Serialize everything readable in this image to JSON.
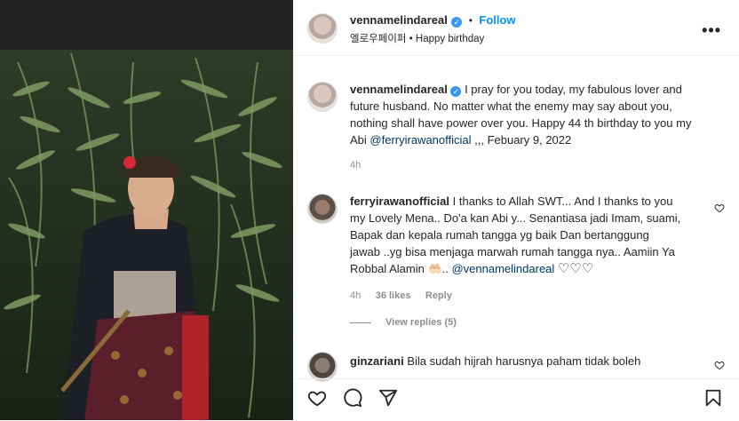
{
  "post": {
    "author": "vennamelindareal",
    "follow_label": "Follow",
    "dot": "•",
    "audio_artist": "엘로우페이퍼",
    "audio_separator": "•",
    "audio_track": "Happy birthday",
    "more_label": "•••"
  },
  "caption": {
    "username": "vennamelindareal",
    "text_line1": "I pray for you today, my fabulous lover and",
    "text_line2": "future husband. No matter what the enemy may say about you,",
    "text_line3": "nothing shall have power over you. Happy 44 th birthday to you my",
    "text_line4_pre": "Abi ",
    "mention": "@ferryirawanofficial",
    "text_line4_post": " ,,, Febuary 9, 2022",
    "time": "4h"
  },
  "comments": [
    {
      "username": "ferryirawanofficial",
      "line1": "I thanks to Allah SWT... And I thanks to you",
      "line2": "my Lovely Mena.. Do'a kan Abi y... Senantiasa jadi Imam, suami,",
      "line3": "Bapak dan kepala rumah tangga yg baik Dan bertanggung",
      "line4": "jawab ..yg bisa menjaga marwah rumah tangga nya.. Aamiin Ya",
      "line5_pre": "Robbal Alamin ",
      "emoji": "🤲🏻",
      "line5_mid": ".. ",
      "mention": "@vennamelindareal",
      "hearts": "♡♡♡",
      "time": "4h",
      "likes": "36 likes",
      "reply": "Reply",
      "view_replies": "View replies (5)"
    },
    {
      "username": "ginzariani",
      "text": "Bila sudah hijrah harusnya paham tidak boleh"
    }
  ],
  "icons": {
    "like": "heart-icon",
    "comment": "comment-icon",
    "share": "share-icon",
    "save": "bookmark-icon"
  }
}
